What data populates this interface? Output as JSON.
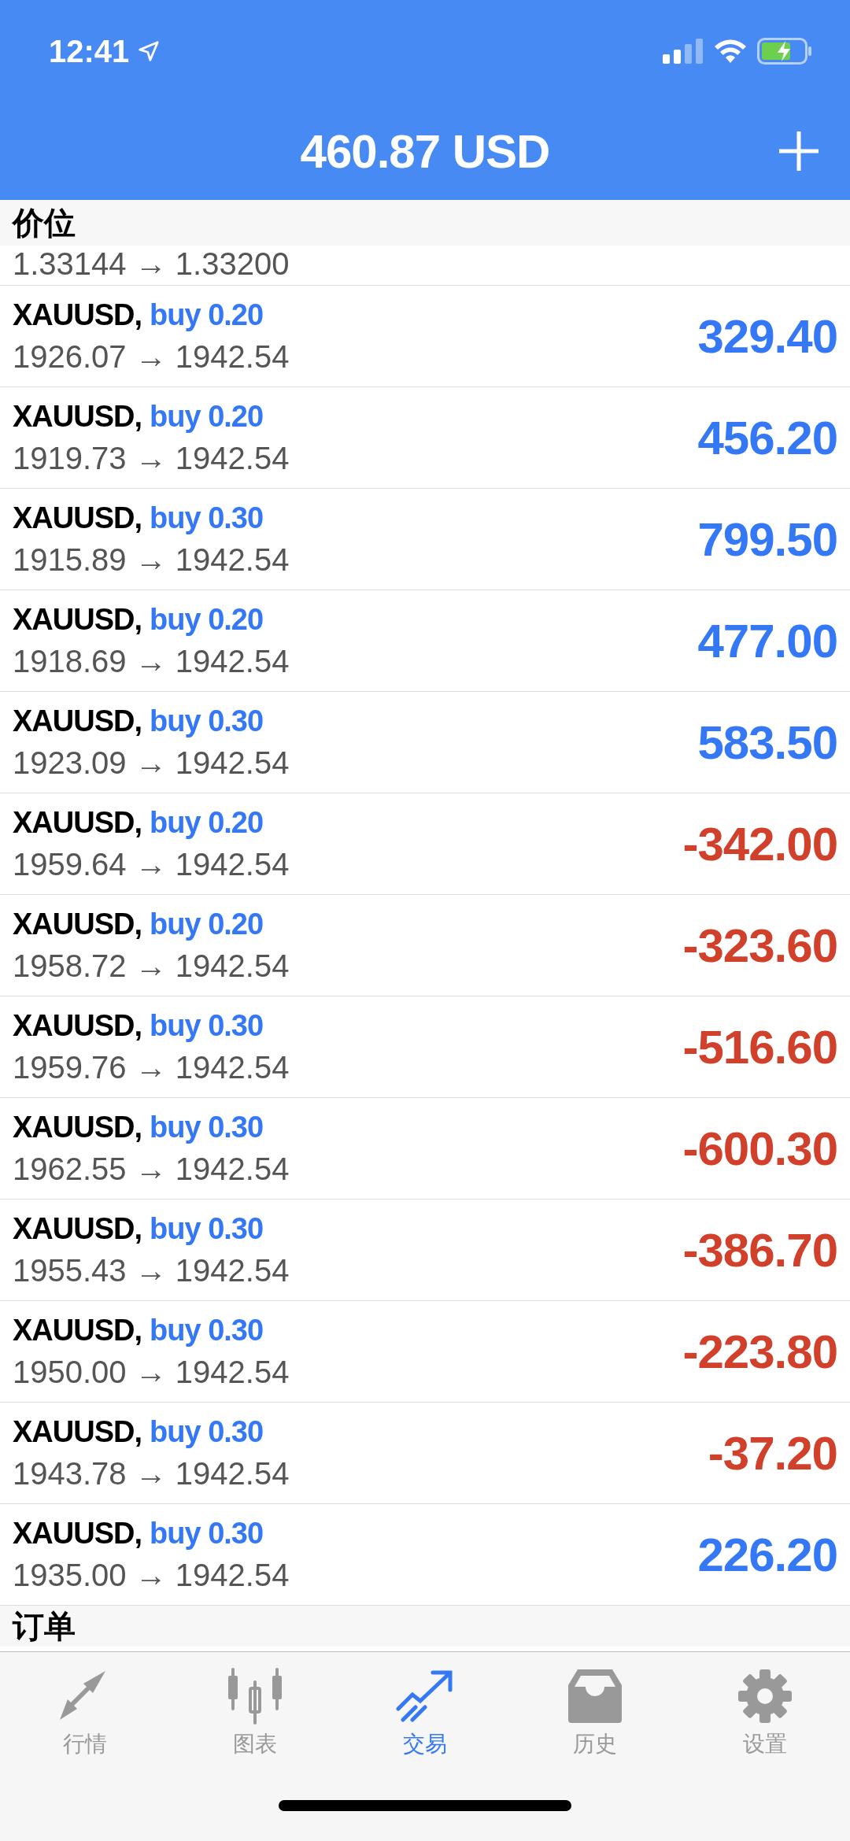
{
  "status_bar": {
    "time": "12:41"
  },
  "nav": {
    "title": "460.87 USD"
  },
  "sections": [
    {
      "title": "价位",
      "partial_row": {
        "prices": "1.33144 → 1.33200"
      },
      "rows": [
        {
          "symbol": "XAUUSD,",
          "side": "buy 0.20",
          "prices": "1926.07 → 1942.54",
          "profit": "329.40",
          "color": "#3478f6"
        },
        {
          "symbol": "XAUUSD,",
          "side": "buy 0.20",
          "prices": "1919.73 → 1942.54",
          "profit": "456.20",
          "color": "#3478f6"
        },
        {
          "symbol": "XAUUSD,",
          "side": "buy 0.30",
          "prices": "1915.89 → 1942.54",
          "profit": "799.50",
          "color": "#3478f6"
        },
        {
          "symbol": "XAUUSD,",
          "side": "buy 0.20",
          "prices": "1918.69 → 1942.54",
          "profit": "477.00",
          "color": "#3478f6"
        },
        {
          "symbol": "XAUUSD,",
          "side": "buy 0.30",
          "prices": "1923.09 → 1942.54",
          "profit": "583.50",
          "color": "#3478f6"
        },
        {
          "symbol": "XAUUSD,",
          "side": "buy 0.20",
          "prices": "1959.64 → 1942.54",
          "profit": "-342.00",
          "color": "#d0402b"
        },
        {
          "symbol": "XAUUSD,",
          "side": "buy 0.20",
          "prices": "1958.72 → 1942.54",
          "profit": "-323.60",
          "color": "#d0402b"
        },
        {
          "symbol": "XAUUSD,",
          "side": "buy 0.30",
          "prices": "1959.76 → 1942.54",
          "profit": "-516.60",
          "color": "#d0402b"
        },
        {
          "symbol": "XAUUSD,",
          "side": "buy 0.30",
          "prices": "1962.55 → 1942.54",
          "profit": "-600.30",
          "color": "#d0402b"
        },
        {
          "symbol": "XAUUSD,",
          "side": "buy 0.30",
          "prices": "1955.43 → 1942.54",
          "profit": "-386.70",
          "color": "#d0402b"
        },
        {
          "symbol": "XAUUSD,",
          "side": "buy 0.30",
          "prices": "1950.00 → 1942.54",
          "profit": "-223.80",
          "color": "#d0402b"
        },
        {
          "symbol": "XAUUSD,",
          "side": "buy 0.30",
          "prices": "1943.78 → 1942.54",
          "profit": "-37.20",
          "color": "#d0402b"
        },
        {
          "symbol": "XAUUSD,",
          "side": "buy 0.30",
          "prices": "1935.00 → 1942.54",
          "profit": "226.20",
          "color": "#3478f6"
        }
      ]
    },
    {
      "title": "订单"
    }
  ],
  "tabs": [
    {
      "label": "行情",
      "kind": "quotes",
      "selected": false
    },
    {
      "label": "图表",
      "kind": "chart",
      "selected": false
    },
    {
      "label": "交易",
      "kind": "trade",
      "selected": true
    },
    {
      "label": "历史",
      "kind": "history",
      "selected": false
    },
    {
      "label": "设置",
      "kind": "settings",
      "selected": false
    }
  ]
}
